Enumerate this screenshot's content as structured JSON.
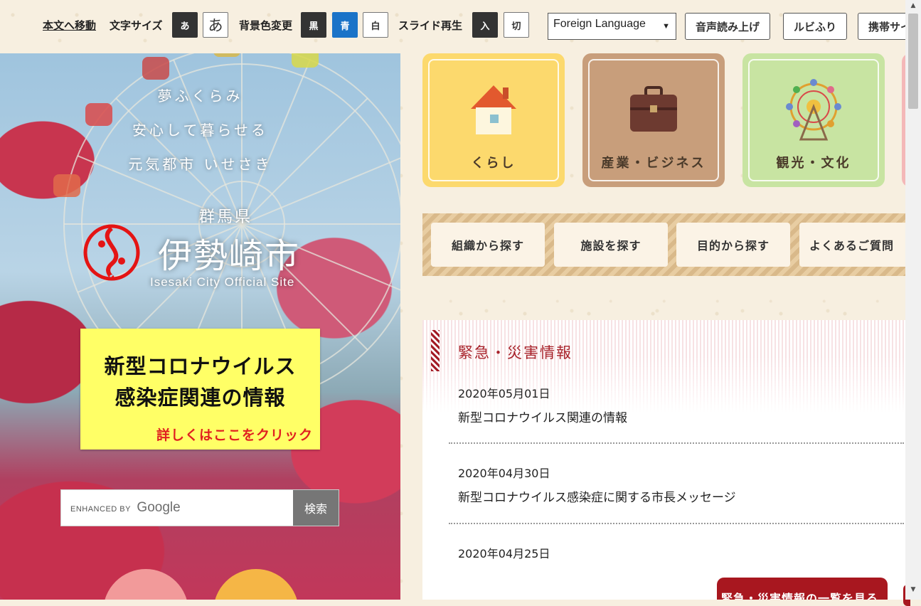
{
  "topbar": {
    "skip_link": "本文へ移動",
    "font_size_label": "文字サイズ",
    "font_small": "あ",
    "font_large": "あ",
    "bg_label": "背景色変更",
    "bg_black": "黒",
    "bg_blue": "青",
    "bg_white": "白",
    "slide_label": "スライド再生",
    "slide_on": "入",
    "slide_off": "切",
    "language_select": "Foreign Language",
    "read_aloud": "音声読み上げ",
    "ruby": "ルビふり",
    "mobile_site": "携帯サイト"
  },
  "hero": {
    "tagline": [
      "夢ふくらみ",
      "安心して暮らせる",
      "元気都市 いせさき"
    ],
    "prefecture": "群馬県",
    "city_name": "伊勢崎市",
    "city_subtitle": "Isesaki City Official Site",
    "covid_banner": {
      "line1": "新型コロナウイルス",
      "line2": "感染症関連の情報",
      "more": "詳しくはここをクリック"
    },
    "search": {
      "placeholder_prefix": "ENHANCED BY",
      "placeholder_brand": "Google",
      "button": "検索"
    }
  },
  "categories": [
    {
      "label": "くらし",
      "icon": "house-icon"
    },
    {
      "label": "産業・ビジネス",
      "icon": "briefcase-icon"
    },
    {
      "label": "観光・文化",
      "icon": "ferris-wheel-icon"
    }
  ],
  "search_by": [
    {
      "label": "組織から探す"
    },
    {
      "label": "施設を探す"
    },
    {
      "label": "目的から探す"
    },
    {
      "label": "よくあるご質問"
    }
  ],
  "emergency": {
    "heading": "緊急・災害情報",
    "items": [
      {
        "date": "2020年05月01日",
        "title": "新型コロナウイルス関連の情報"
      },
      {
        "date": "2020年04月30日",
        "title": "新型コロナウイルス感染症に関する市長メッセージ"
      },
      {
        "date": "2020年04月25日",
        "title": ""
      }
    ],
    "list_button": "緊急・災害情報の一覧を見る"
  },
  "colors": {
    "accent_red": "#a8232b",
    "bg_blue": "#1a73c8",
    "banner_yellow": "#ffff66"
  }
}
